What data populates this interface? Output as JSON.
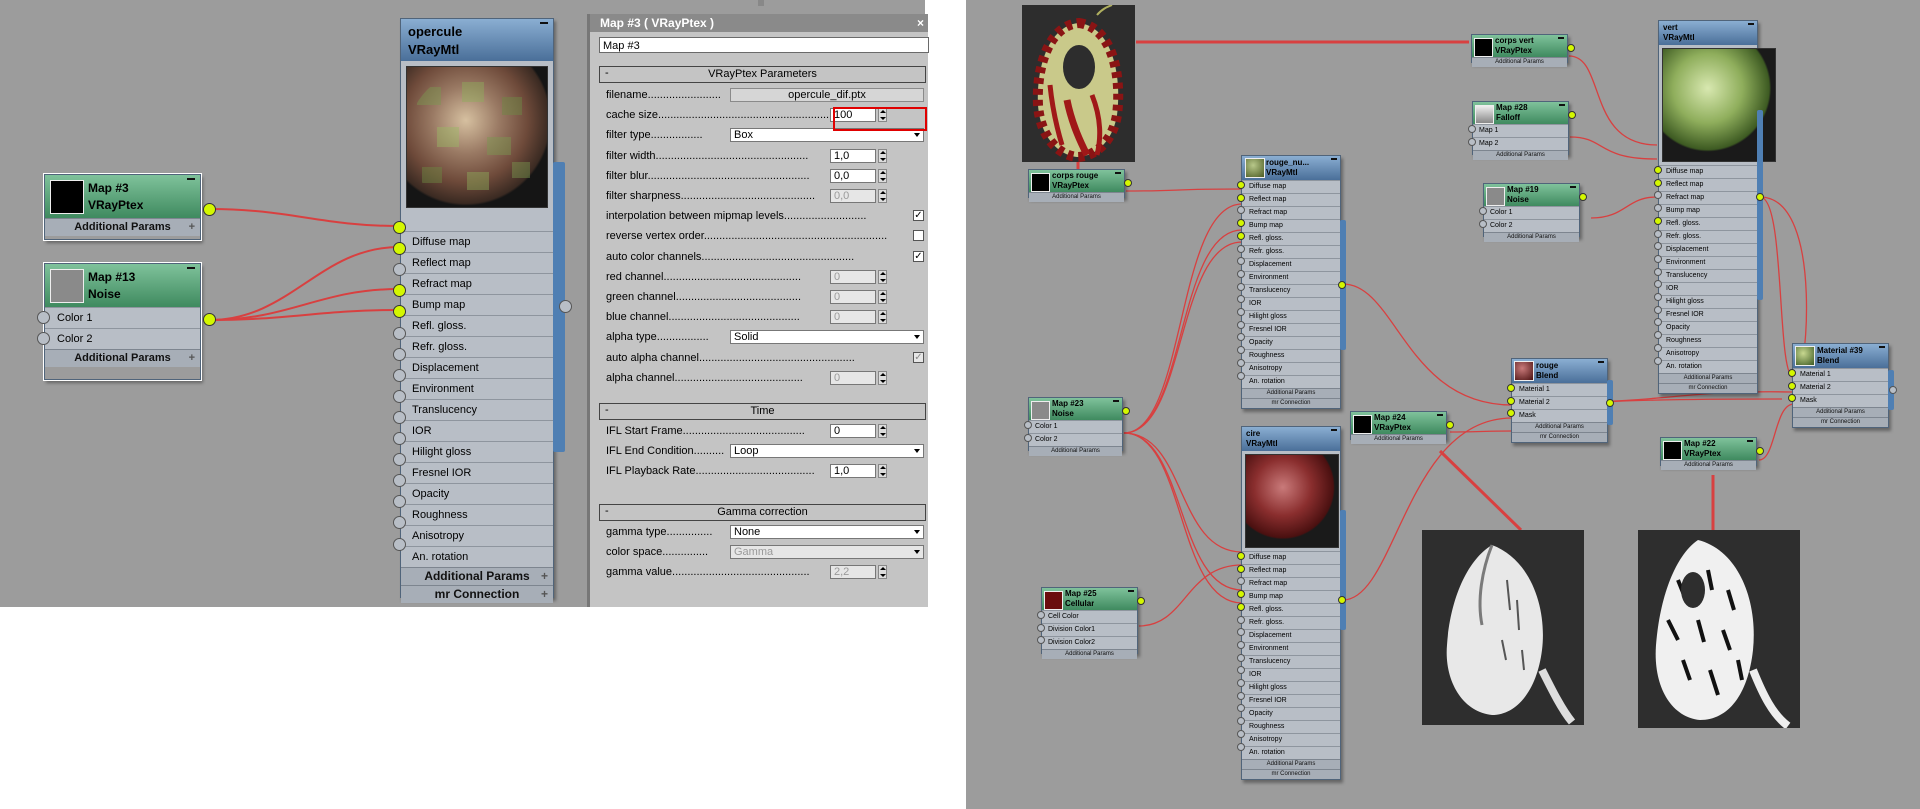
{
  "left_editor": {
    "map3": {
      "title": "Map #3",
      "type": "VRayPtex",
      "extra": "Additional Params"
    },
    "map13": {
      "title": "Map #13",
      "type": "Noise",
      "slots": [
        "Color 1",
        "Color 2"
      ],
      "extra": "Additional Params"
    },
    "opercule": {
      "title": "opercule",
      "type": "VRayMtl",
      "slots": [
        "Diffuse map",
        "Reflect map",
        "Refract map",
        "Bump map",
        "Refl. gloss.",
        "Refr. gloss.",
        "Displacement",
        "Environment",
        "Translucency",
        "IOR",
        "Hilight gloss",
        "Fresnel IOR",
        "Opacity",
        "Roughness",
        "Anisotropy",
        "An. rotation"
      ],
      "connected": [
        true,
        true,
        false,
        true,
        true,
        false,
        false,
        false,
        false,
        false,
        false,
        false,
        false,
        false,
        false,
        false
      ],
      "extra1": "Additional Params",
      "extra2": "mr Connection"
    }
  },
  "panel": {
    "title": "Map #3  ( VRayPtex )",
    "close": "×",
    "name_field": "Map #3",
    "sections": {
      "params": "VRayPtex Parameters",
      "time": "Time",
      "gamma": "Gamma correction"
    },
    "collapse": "-",
    "rows": [
      {
        "label": "filename........................",
        "button": "opercule_dif.ptx"
      },
      {
        "label": "cache size..........................................................",
        "value": "100"
      },
      {
        "label": "filter type.................",
        "select": "Box"
      },
      {
        "label": "filter width..................................................",
        "value": "1,0"
      },
      {
        "label": "filter blur.....................................................",
        "value": "0,0"
      },
      {
        "label": "filter sharpness............................................",
        "value": "0,0"
      },
      {
        "label": "interpolation between mipmap levels...........................",
        "check": "✓"
      },
      {
        "label": "reverse vertex order............................................................",
        "check": ""
      },
      {
        "label": "auto color channels..................................................",
        "check": "✓"
      },
      {
        "label": "red channel.............................................",
        "value": "0"
      },
      {
        "label": "green channel.........................................",
        "value": "0"
      },
      {
        "label": "blue channel...........................................",
        "value": "0"
      },
      {
        "label": "alpha type.................",
        "select": "Solid"
      },
      {
        "label": "auto alpha channel...................................................",
        "check": "✓"
      },
      {
        "label": "alpha channel..........................................",
        "value": "0"
      }
    ],
    "time_rows": [
      {
        "label": "IFL Start Frame........................................",
        "value": "0"
      },
      {
        "label": "IFL End Condition..........",
        "select": "Loop"
      },
      {
        "label": "IFL Playback Rate.......................................",
        "value": "1,0"
      }
    ],
    "gamma_rows": [
      {
        "label": "gamma type...............",
        "select": "None"
      },
      {
        "label": "color space...............",
        "select": "Gamma"
      },
      {
        "label": "gamma value.............................................",
        "value": "2,2"
      }
    ]
  },
  "right_editor": {
    "corps_rouge": {
      "title": "corps rouge",
      "type": "VRayPtex",
      "extra": "Additional Params"
    },
    "corps_vert": {
      "title": "corps vert",
      "type": "VRayPtex",
      "extra": "Additional Params"
    },
    "map28": {
      "title": "Map #28",
      "type": "Falloff",
      "slots": [
        "Map 1",
        "Map 2"
      ],
      "extra": "Additional Params"
    },
    "map19": {
      "title": "Map #19",
      "type": "Noise",
      "slots": [
        "Color 1",
        "Color 2"
      ],
      "extra": "Additional Params"
    },
    "map23": {
      "title": "Map #23",
      "type": "Noise",
      "slots": [
        "Color 1",
        "Color 2"
      ],
      "extra": "Additional Params"
    },
    "map24": {
      "title": "Map #24",
      "type": "VRayPtex",
      "extra": "Additional Params"
    },
    "map25": {
      "title": "Map #25",
      "type": "Cellular",
      "slots": [
        "Cell Color",
        "Division Color1",
        "Division Color2"
      ],
      "extra": "Additional Params"
    },
    "map22": {
      "title": "Map #22",
      "type": "VRayPtex",
      "extra": "Additional Params"
    },
    "rouge_nu": {
      "title": "rouge_nu...",
      "type": "VRayMtl",
      "slots": [
        "Diffuse map",
        "Reflect map",
        "Refract map",
        "Bump map",
        "Refl. gloss.",
        "Refr. gloss.",
        "Displacement",
        "Environment",
        "Translucency",
        "IOR",
        "Hilight gloss",
        "Fresnel IOR",
        "Opacity",
        "Roughness",
        "Anisotropy",
        "An. rotation"
      ],
      "connected": [
        true,
        true,
        false,
        true,
        true,
        false,
        false,
        false,
        false,
        false,
        false,
        false,
        false,
        false,
        false,
        false
      ],
      "extra1": "Additional Params",
      "extra2": "mr Connection"
    },
    "cire": {
      "title": "cire",
      "type": "VRayMtl",
      "slots": [
        "Diffuse map",
        "Reflect map",
        "Refract map",
        "Bump map",
        "Refl. gloss.",
        "Refr. gloss.",
        "Displacement",
        "Environment",
        "Translucency",
        "IOR",
        "Hilight gloss",
        "Fresnel IOR",
        "Opacity",
        "Roughness",
        "Anisotropy",
        "An. rotation"
      ],
      "connected": [
        true,
        true,
        false,
        true,
        true,
        false,
        false,
        false,
        false,
        false,
        false,
        false,
        false,
        false,
        false,
        false
      ],
      "extra1": "Additional Params",
      "extra2": "mr Connection"
    },
    "vert": {
      "title": "vert",
      "type": "VRayMtl",
      "slots": [
        "Diffuse map",
        "Reflect map",
        "Refract map",
        "Bump map",
        "Refl. gloss.",
        "Refr. gloss.",
        "Displacement",
        "Environment",
        "Translucency",
        "IOR",
        "Hilight gloss",
        "Fresnel IOR",
        "Opacity",
        "Roughness",
        "Anisotropy",
        "An. rotation"
      ],
      "connected": [
        true,
        true,
        false,
        false,
        true,
        false,
        false,
        false,
        false,
        false,
        false,
        false,
        false,
        false,
        false,
        false
      ],
      "extra1": "Additional Params",
      "extra2": "mr Connection"
    },
    "rouge_blend": {
      "title": "rouge",
      "type": "Blend",
      "slots": [
        "Material 1",
        "Material 2",
        "Mask"
      ],
      "connected": [
        true,
        true,
        true
      ],
      "extra1": "Additional Params",
      "extra2": "mr Connection"
    },
    "material39": {
      "title": "Material #39",
      "type": "Blend",
      "slots": [
        "Material 1",
        "Material 2",
        "Mask"
      ],
      "connected": [
        true,
        true,
        true
      ],
      "extra1": "Additional Params",
      "extra2": "mr Connection"
    }
  },
  "colors": {
    "wire": "#d84040",
    "socket_on": "#d4f700",
    "highlight": "#e00000",
    "editor_bg": "#9c9c9c"
  }
}
